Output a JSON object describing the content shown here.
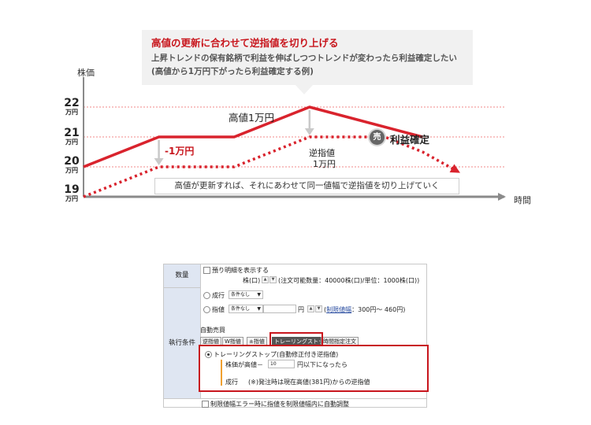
{
  "diagram": {
    "callout": {
      "title": "高値の更新に合わせて逆指値を切り上げる",
      "line1": "上昇トレンドの保有銘柄で利益を伸ばしつつトレンドが変わったら利益確定したい",
      "line2": "(高値から1万円下がったら利益確定する例)"
    },
    "y_axis_label": "株価",
    "x_axis_label": "時間",
    "y_ticks": [
      {
        "value": "22",
        "unit": "万円"
      },
      {
        "value": "21",
        "unit": "万円"
      },
      {
        "value": "20",
        "unit": "万円"
      },
      {
        "value": "19",
        "unit": "万円"
      }
    ],
    "label_high": "高値1万円",
    "label_drop": "-1万円",
    "label_stop_line1": "逆指値",
    "label_stop_line2": "1万円",
    "sell_badge": "売",
    "label_sell": "利益確定",
    "note": "高値が更新すれば、それにあわせて同一値幅で逆指値を切り上げていく",
    "colors": {
      "price_line": "#d9232d",
      "grid": "#f08a8a",
      "axis": "#8a8a8a",
      "arrow": "#c9c9c9"
    }
  },
  "chart_data": {
    "type": "line",
    "y_unit": "万円",
    "ylim": [
      19,
      22
    ],
    "series": [
      {
        "style": "solid",
        "x": [
          0,
          2,
          4,
          6,
          9
        ],
        "y": [
          20,
          21,
          21,
          22,
          21
        ]
      },
      {
        "style": "dotted",
        "x": [
          0,
          2,
          4,
          6,
          8,
          9,
          10
        ],
        "y": [
          19,
          20,
          20,
          21,
          21,
          20.5,
          19.8
        ]
      }
    ]
  },
  "form": {
    "qty_header": "数量",
    "exec_header": "執行条件",
    "show_breakdown": "預り明細を表示する",
    "qty_line": "株(口)",
    "qty_info": "(注文可能数量：40000株(口)/単位：1000株(口))",
    "market_label": "成行",
    "condition_none": "条件なし",
    "limit_label": "指値",
    "yen": "円",
    "price_range_link": "制限値幅",
    "price_range_value": "：300円～ 460円)",
    "price_range_open": "(",
    "auto_trade": "自動売買",
    "tabs": [
      "逆指値",
      "W指値",
      "±指値",
      "トレーリングストップ",
      "時間指定注文"
    ],
    "ts_option": "トレーリングストップ(自動修正付き逆指値)",
    "ts_condition_prefix": "株価が高値－",
    "ts_value": "10",
    "ts_condition_suffix": "円以下になったら",
    "ts_order_type": "成行",
    "ts_note": "(※)発注時は現在高値(381円)からの逆指値",
    "auto_adjust": "制限値幅エラー時に指値を制限値幅内に自動調整",
    "spin_up": "▲",
    "spin_down": "▼",
    "select_arrow": "▼"
  }
}
